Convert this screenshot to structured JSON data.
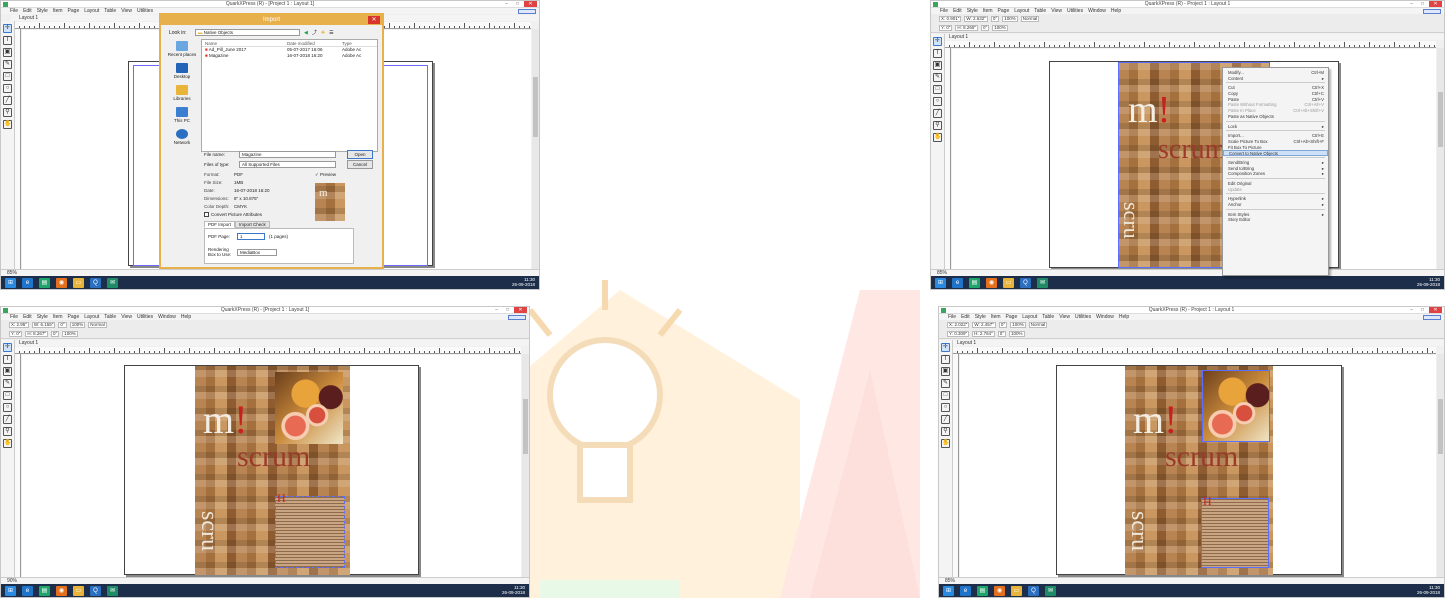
{
  "app_title_import": "QuarkXPress (R) - [Project 1 : Layout 1]",
  "app_title": "QuarkXPress (R) - Project 1 : Layout 1",
  "window_controls": {
    "minimize": "–",
    "maximize": "□",
    "close": "✕"
  },
  "menu": [
    "File",
    "Edit",
    "Style",
    "Item",
    "Page",
    "Layout",
    "Table",
    "View",
    "Utilities",
    "Window",
    "Help"
  ],
  "menu_short": [
    "File",
    "Edit",
    "Style",
    "Item",
    "Page",
    "Layout",
    "Table",
    "View",
    "Utilities"
  ],
  "layout_tab": "Layout 1",
  "status": {
    "zoom": "85%",
    "page_field": "1",
    "zoom3": "90%"
  },
  "measurements": {
    "x1": "X: 0.901\"",
    "y1": "Y: 0\"",
    "w1": "W: 2.632\"",
    "h1": "H: 8.265\"",
    "angle": "0°",
    "scale": "100%",
    "mode": "Normal",
    "x3": "X: 2.95\"",
    "y3": "Y: 0\"",
    "w3": "W: 6.155\"",
    "h3": "H: 8.267\"",
    "x4": "X: 2.022\"",
    "y4": "Y: 0.309\"",
    "w4": "W: 2.457\"",
    "h4": "H: 2.764\""
  },
  "import_dialog": {
    "title": "Import",
    "look_in_label": "Look in:",
    "look_in_value": "Native Objects",
    "places": [
      "Recent places",
      "Desktop",
      "Libraries",
      "This PC",
      "Network"
    ],
    "columns": [
      "Name",
      "Date modified",
      "Type"
    ],
    "files": [
      {
        "name": "Ad_Pill_June 2017",
        "date": "05-07-2017 16:06",
        "type": "Adobe Ac"
      },
      {
        "name": "Magazine",
        "date": "16-07-2018 16:20",
        "type": "Adobe Ac"
      }
    ],
    "file_name_label": "File name:",
    "file_name_value": "Magazine",
    "files_type_label": "Files of type:",
    "files_type_value": "All Supported Files",
    "open_button": "Open",
    "cancel_button": "Cancel",
    "meta": [
      {
        "k": "Format:",
        "v": "PDF"
      },
      {
        "k": "File Size:",
        "v": "1MB"
      },
      {
        "k": "Date:",
        "v": "16-07-2018 16:20"
      },
      {
        "k": "Dimensions:",
        "v": "8\" x 10.875\""
      },
      {
        "k": "Color Depth:",
        "v": "CMYK"
      }
    ],
    "preview_label": "Preview",
    "convert_label": "Convert Picture Attributes",
    "tabs": [
      "PDF Import",
      "Import Check"
    ],
    "pdf_page_label": "PDF Page:",
    "pdf_page_value": "1",
    "pdf_page_count": "(1 pages)",
    "render_label": "Rendering Box to Use:",
    "render_value": "MediaBox"
  },
  "context_menu": [
    {
      "label": "Modify...",
      "key": "Ctrl+M"
    },
    {
      "label": "Content",
      "key": "▸"
    },
    {
      "sep": true
    },
    {
      "label": "Cut",
      "key": "Ctrl+X"
    },
    {
      "label": "Copy",
      "key": "Ctrl+C"
    },
    {
      "label": "Paste",
      "key": "Ctrl+V"
    },
    {
      "label": "Paste Without Formatting",
      "key": "Ctrl+Alt+V",
      "dis": true
    },
    {
      "label": "Paste In Place",
      "key": "Ctrl+Alt+Shift+V",
      "dis": true
    },
    {
      "label": "Paste as Native Objects",
      "key": ""
    },
    {
      "sep": true
    },
    {
      "label": "Lock",
      "key": "▸"
    },
    {
      "sep": true
    },
    {
      "label": "Import...",
      "key": "Ctrl+E"
    },
    {
      "label": "Scale Picture To Box",
      "key": "Ctrl+Alt+Shift+F"
    },
    {
      "label": "Fit Box To Picture",
      "key": ""
    },
    {
      "label": "Convert to Native Objects",
      "key": "",
      "hl": true
    },
    {
      "sep": true
    },
    {
      "label": "Send/Bring",
      "key": "▸"
    },
    {
      "label": "Send to/Bring",
      "key": "▸"
    },
    {
      "label": "Composition Zones",
      "key": "▸"
    },
    {
      "sep": true
    },
    {
      "label": "Edit Original",
      "key": ""
    },
    {
      "label": "Update",
      "key": "",
      "dis": true
    },
    {
      "sep": true
    },
    {
      "label": "Hyperlink",
      "key": "▸"
    },
    {
      "label": "Anchor",
      "key": "▸"
    },
    {
      "sep": true
    },
    {
      "label": "Item Styles",
      "key": "▸"
    },
    {
      "label": "Story Editor",
      "key": ""
    }
  ],
  "cover": {
    "m": "m",
    "bang": "!",
    "scrum": "scrum",
    "vertical": "scru",
    "h": "H"
  },
  "taskbar": {
    "time": "11:30",
    "date": "26-09-2018"
  },
  "icons": {
    "tools": [
      "item-tool-icon",
      "text-tool-icon",
      "picture-tool-icon",
      "pen-tool-icon",
      "rectangle-icon",
      "oval-icon",
      "line-icon",
      "zoom-icon",
      "pan-icon"
    ],
    "taskbar": [
      "windows-start-icon",
      "ie-icon",
      "store-icon",
      "firefox-icon",
      "explorer-icon",
      "quark-icon",
      "outlook-icon"
    ]
  },
  "colors": {
    "quark_green": "#3aa55c",
    "dialog_accent": "#e8b04a",
    "close_red": "#e04343",
    "taskbar": "#1d2e4a",
    "selection": "#5b6fff"
  }
}
